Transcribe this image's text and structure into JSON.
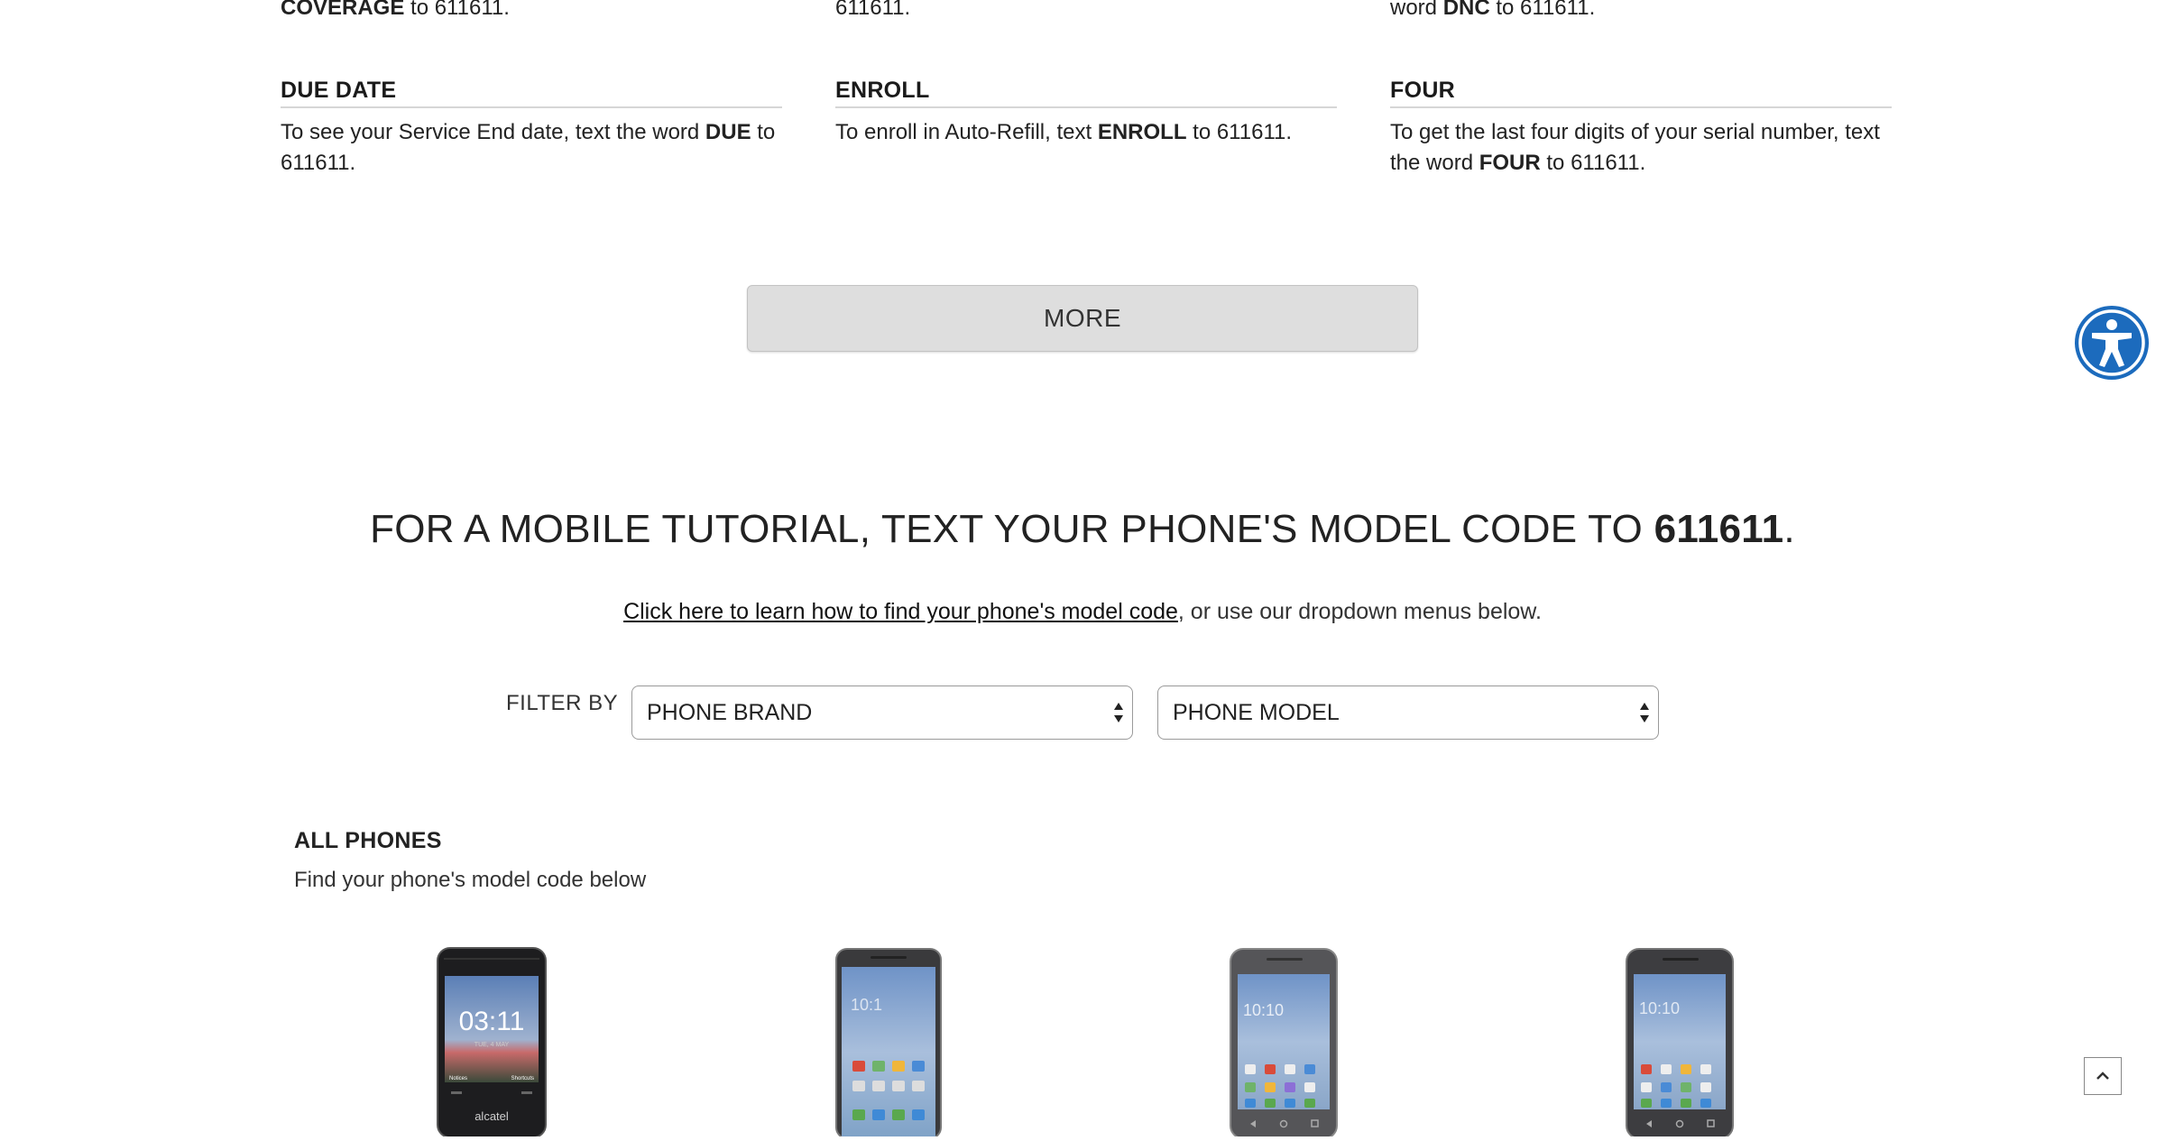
{
  "top_row": {
    "col1": {
      "bold": "COVERAGE",
      "rest": " to 611611."
    },
    "col2": {
      "text": "611611."
    },
    "col3": {
      "pre": "word ",
      "bold": "DNC",
      "rest": " to 611611."
    }
  },
  "cards": [
    {
      "title": "DUE DATE",
      "pre": "To see your Service End date, text the word ",
      "bold": "DUE",
      "rest": " to 611611."
    },
    {
      "title": "ENROLL",
      "pre": "To enroll in Auto-Refill, text ",
      "bold": "ENROLL",
      "rest": " to 611611."
    },
    {
      "title": "FOUR",
      "pre": "To get the last four digits of your serial number, text the word ",
      "bold": "FOUR",
      "rest": " to 611611."
    }
  ],
  "more_button": "MORE",
  "tutorial": {
    "pre": "FOR A MOBILE TUTORIAL, TEXT YOUR PHONE'S MODEL CODE TO ",
    "bold": "611611",
    "post": "."
  },
  "help": {
    "link": "Click here to learn how to find your phone's model code",
    "rest": ", or use our dropdown menus below."
  },
  "filter": {
    "label": "FILTER BY",
    "brand_select": "PHONE BRAND",
    "model_select": "PHONE MODEL"
  },
  "all_phones": {
    "title": "ALL PHONES",
    "subtitle": "Find your phone's model code below"
  },
  "phones": [
    {
      "screen_time": "03:11",
      "screen_date": "TUE, 4 MAY",
      "soft_left": "Notices",
      "soft_right": "Shortcuts",
      "brand": "alcatel"
    },
    {
      "screen_time": "10:1"
    },
    {
      "screen_time": "10:10"
    },
    {
      "screen_time": "10:10"
    }
  ],
  "colors": {
    "accessibility": "#1c6bbd",
    "button_bg": "#dedede",
    "divider": "#d6d6d6"
  },
  "icons": {
    "accessibility": "accessibility-icon",
    "scroll_top": "chevron-up-icon",
    "select": "updown-arrows-icon"
  }
}
